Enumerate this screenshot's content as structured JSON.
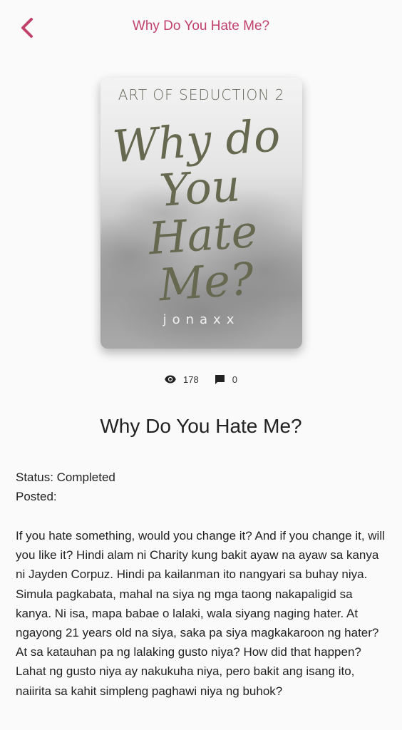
{
  "header": {
    "title": "Why Do You Hate Me?"
  },
  "cover": {
    "series": "ART OF SEDUCTION 2",
    "title_lines": [
      "Why do",
      "You Hate",
      "Me?"
    ],
    "author": "jonaxx"
  },
  "stats": {
    "views": "178",
    "comments": "0"
  },
  "book": {
    "title": "Why Do You Hate Me?",
    "status_label": "Status: Completed",
    "posted_label": "Posted:",
    "description": "If you hate something, would you change it? And if you change it, will you like it? Hindi alam ni Charity kung bakit ayaw na ayaw sa kanya ni Jayden Corpuz. Hindi pa kailanman ito nangyari sa buhay niya. Simula pagkabata, mahal na siya ng mga taong nakapaligid sa kanya. Ni isa, mapa babae o lalaki, wala siyang naging hater. At ngayong 21 years old na siya, saka pa siya magkakaroon ng hater? At sa katauhan pa ng lalaking gusto niya? How did that happen? Lahat ng gusto niya ay nakukuha niya, pero bakit ang isang ito, naiirita sa kahit simpleng paghawi niya ng buhok?"
  },
  "colors": {
    "accent": "#c1416b",
    "background": "#fafafa",
    "text": "#222222",
    "cover_script": "#66684f"
  },
  "icons": {
    "back": "chevron-left-icon",
    "views": "eye-icon",
    "comments": "comment-icon"
  }
}
